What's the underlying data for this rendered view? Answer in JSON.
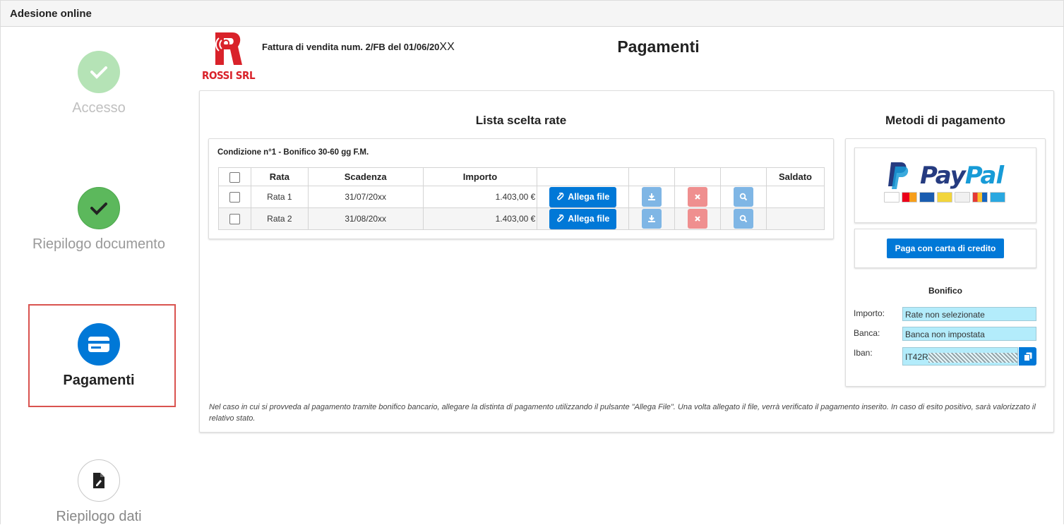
{
  "window": {
    "title": "Adesione online"
  },
  "steps": [
    {
      "label": "Accesso",
      "state": "done-faded",
      "icon": "check-icon"
    },
    {
      "label": "Riepilogo documento",
      "state": "done",
      "icon": "check-icon"
    },
    {
      "label": "Pagamenti",
      "state": "active",
      "icon": "credit-card-icon"
    },
    {
      "label": "Riepilogo dati",
      "state": "todo",
      "icon": "document-edit-icon"
    }
  ],
  "header": {
    "logo_text": "ROSSI SRL",
    "invoice_text": "Fattura di vendita num. 2/FB del 01/06/20",
    "invoice_suffix": "XX",
    "page_title": "Pagamenti"
  },
  "rates": {
    "section_title": "Lista scelta rate",
    "condition": "Condizione n°1 - Bonifico 30-60 gg F.M.",
    "columns": [
      "Rata",
      "Scadenza",
      "Importo",
      "Saldato"
    ],
    "rows": [
      {
        "rata": "Rata 1",
        "scadenza": "31/07/20",
        "scadenza_suffix": "xx",
        "importo": "1.403,00 €",
        "attach_label": "Allega file"
      },
      {
        "rata": "Rata 2",
        "scadenza": "31/08/20",
        "scadenza_suffix": "xx",
        "importo": "1.403,00 €",
        "attach_label": "Allega file"
      }
    ]
  },
  "payment_methods": {
    "section_title": "Metodi di pagamento",
    "paypal": {
      "word_1": "Pay",
      "word_2": "Pal"
    },
    "credit_card_button": "Paga con carta di credito",
    "bonifico": {
      "title": "Bonifico",
      "importo_label": "Importo:",
      "importo_value": "Rate non selezionate",
      "banca_label": "Banca:",
      "banca_value": "Banca non impostata",
      "iban_label": "Iban:",
      "iban_prefix": "IT42R"
    }
  },
  "note": "Nel caso in cui si provveda al pagamento tramite bonifico bancario, allegare la distinta di pagamento utilizzando il pulsante \"Allega File\". Una volta allegato il file, verrà verificato il pagamento inserito. In caso di esito positivo, sarà valorizzato il relativo stato.",
  "colors": {
    "primary": "#0078d7",
    "success": "#5cb85c",
    "danger": "#d9534f",
    "field_bg": "#b3ecfb",
    "brand_red": "#d9222a"
  }
}
